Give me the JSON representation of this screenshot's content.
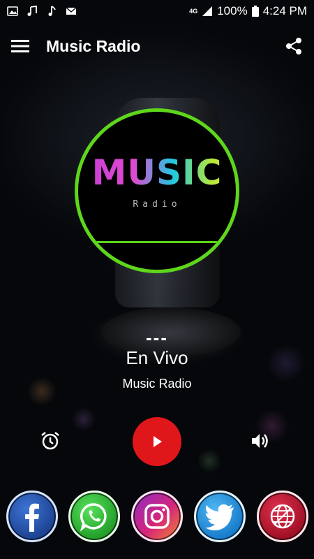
{
  "status_bar": {
    "network": "4G",
    "battery": "100%",
    "time": "4:24 PM",
    "icons": [
      "image-icon",
      "music-note-icon",
      "music-note-icon",
      "mail-icon",
      "signal-icon",
      "battery-icon"
    ]
  },
  "app_bar": {
    "title": "Music Radio",
    "menu_icon": "hamburger-menu-icon",
    "share_icon": "share-icon"
  },
  "logo": {
    "main_text": "MUSIC",
    "sub_text": "Radio"
  },
  "now_playing": {
    "dash": "---",
    "title": "En Vivo",
    "station": "Music Radio"
  },
  "controls": {
    "alarm_icon": "alarm-clock-icon",
    "play_icon": "play-icon",
    "volume_icon": "volume-icon"
  },
  "socials": [
    {
      "name": "facebook",
      "icon": "facebook-icon"
    },
    {
      "name": "whatsapp",
      "icon": "whatsapp-icon"
    },
    {
      "name": "instagram",
      "icon": "instagram-icon"
    },
    {
      "name": "twitter",
      "icon": "twitter-icon"
    },
    {
      "name": "website",
      "icon": "globe-icon"
    }
  ],
  "colors": {
    "accent_ring": "#5ed61c",
    "play_button": "#e0171a"
  }
}
